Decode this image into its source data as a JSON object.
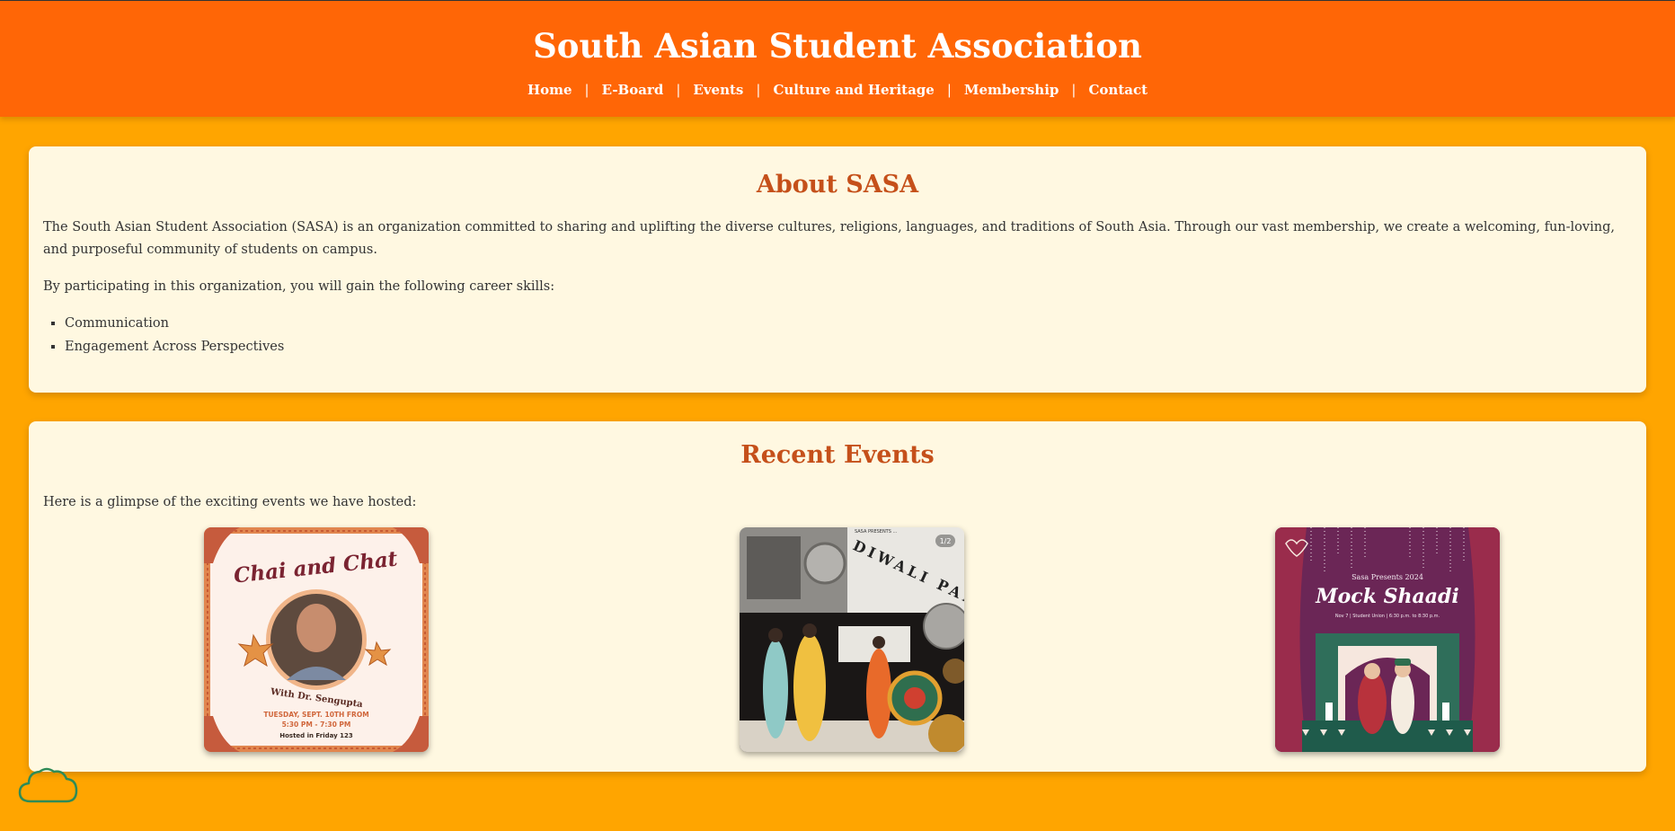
{
  "site": {
    "title": "South Asian Student Association"
  },
  "nav": {
    "items": [
      "Home",
      "E-Board",
      "Events",
      "Culture and Heritage",
      "Membership",
      "Contact"
    ],
    "separator": "|"
  },
  "about": {
    "heading": "About SASA",
    "paragraph1": "The South Asian Student Association (SASA) is an organization committed to sharing and uplifting the diverse cultures, religions, languages, and traditions of South Asia. Through our vast membership, we create a welcoming, fun-loving, and purposeful community of students on campus.",
    "paragraph2": "By participating in this organization, you will gain the following career skills:",
    "skills": [
      "Communication",
      "Engagement Across Perspectives"
    ]
  },
  "events": {
    "heading": "Recent Events",
    "intro": "Here is a glimpse of the exciting events we have hosted:",
    "posters": [
      {
        "title": "Chai and Chat",
        "subtitle": "With Dr. Sengupta",
        "line1": "TUESDAY, SEPT. 10TH FROM",
        "line2": "5:30 PM - 7:30 PM",
        "line3": "Hosted in Friday 123"
      },
      {
        "title": "DIWALI PARTY",
        "counter": "1/2",
        "top_text": "SASA PRESENTS ..."
      },
      {
        "title": "Mock Shaadi",
        "presenter": "Sasa Presents 2024",
        "details": "Nov 7 | Student Union | 6:30 p.m. to 8:30 p.m."
      }
    ]
  },
  "colors": {
    "page_bg": "#FFA500",
    "header_bg": "#FF6606",
    "card_bg": "#FFF8E1",
    "heading": "#C5501A"
  },
  "icons": {
    "cloud": "cloud-icon"
  }
}
